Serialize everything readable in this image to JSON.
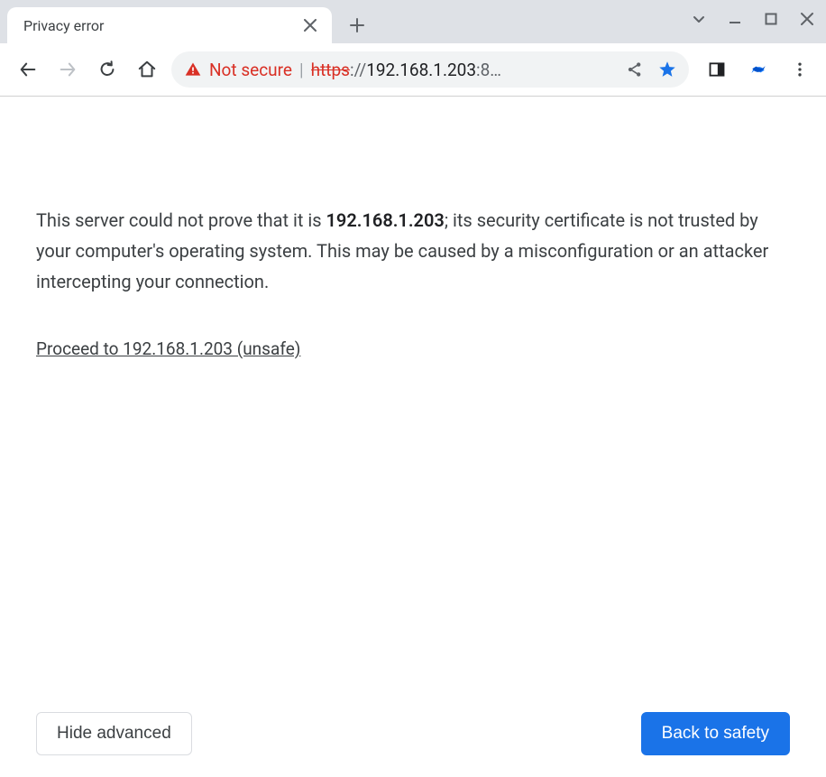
{
  "tab": {
    "title": "Privacy error"
  },
  "omnibox": {
    "not_secure_label": "Not secure",
    "scheme_struck": "https",
    "scheme_rest": "://",
    "host": "192.168.1.203",
    "port_truncated": ":8…"
  },
  "content": {
    "explain_prefix": "This server could not prove that it is ",
    "explain_ip": "192.168.1.203",
    "explain_suffix": "; its security certificate is not trusted by your computer's operating system. This may be caused by a misconfiguration or an attacker intercepting your connection.",
    "proceed_label": "Proceed to 192.168.1.203 (unsafe)",
    "hide_advanced_label": "Hide advanced",
    "back_to_safety_label": "Back to safety"
  }
}
